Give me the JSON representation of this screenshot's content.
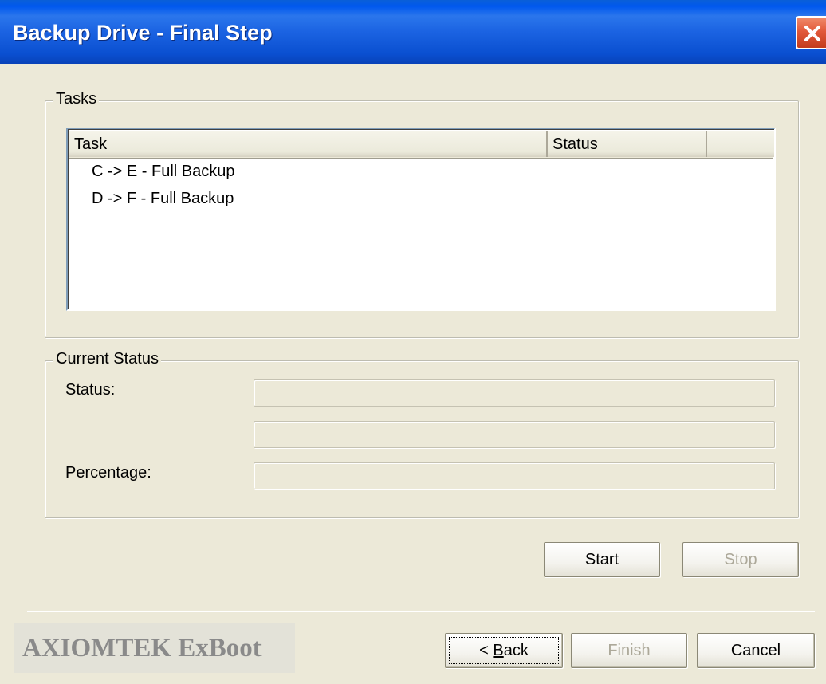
{
  "window": {
    "title": "Backup Drive - Final Step"
  },
  "tasks_group": {
    "legend": "Tasks",
    "columns": [
      "Task",
      "Status",
      ""
    ],
    "rows": [
      {
        "task": "C -> E - Full Backup",
        "status": ""
      },
      {
        "task": "D -> F - Full Backup",
        "status": ""
      }
    ]
  },
  "status_group": {
    "legend": "Current Status",
    "status_label": "Status:",
    "percentage_label": "Percentage:",
    "status_value": "",
    "status_value_2": "",
    "percentage_value": ""
  },
  "actions": {
    "start_label": "Start",
    "stop_label": "Stop"
  },
  "footer": {
    "brand": "AXIOMTEK ExBoot",
    "back_prefix": "< ",
    "back_accel": "B",
    "back_rest": "ack",
    "finish_label": "Finish",
    "cancel_label": "Cancel"
  },
  "colors": {
    "titlebar": "#0a4fd0",
    "face": "#ece9d8",
    "close": "#e2593a",
    "disabled_text": "#aca899"
  }
}
